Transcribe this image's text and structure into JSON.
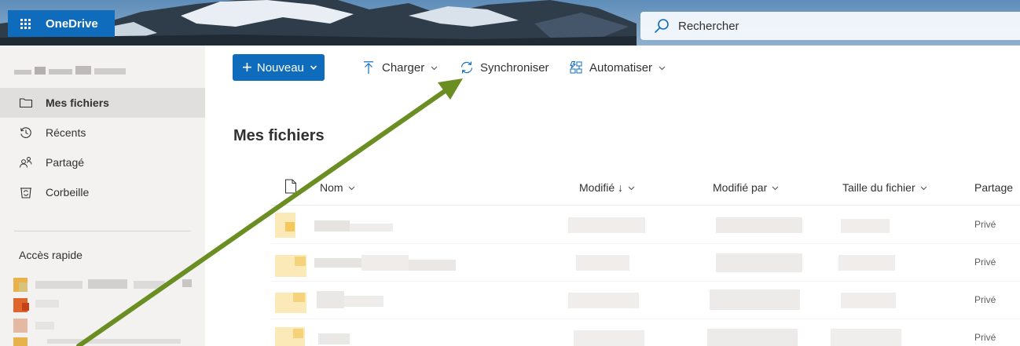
{
  "app": {
    "name": "OneDrive"
  },
  "search": {
    "placeholder": "Rechercher"
  },
  "nav": {
    "items": [
      {
        "label": "Mes fichiers",
        "icon": "folder-icon",
        "active": true
      },
      {
        "label": "Récents",
        "icon": "history-icon",
        "active": false
      },
      {
        "label": "Partagé",
        "icon": "people-icon",
        "active": false
      },
      {
        "label": "Corbeille",
        "icon": "recycle-bin-icon",
        "active": false
      }
    ],
    "quick_access_title": "Accès rapide"
  },
  "toolbar": {
    "new_label": "Nouveau",
    "upload_label": "Charger",
    "sync_label": "Synchroniser",
    "automate_label": "Automatiser"
  },
  "main": {
    "title": "Mes fichiers",
    "columns": [
      "Nom",
      "Modifié ↓",
      "Modifié par",
      "Taille du fichier",
      "Partage"
    ],
    "rows": [
      {
        "sharing": "Privé"
      },
      {
        "sharing": "Privé"
      },
      {
        "sharing": "Privé"
      },
      {
        "sharing": "Privé"
      }
    ]
  },
  "colors": {
    "accent": "#0f6cbd",
    "nav_background": "#f3f2f1",
    "nav_active": "#e1dfdd",
    "annotation_arrow": "#6b8e23"
  }
}
